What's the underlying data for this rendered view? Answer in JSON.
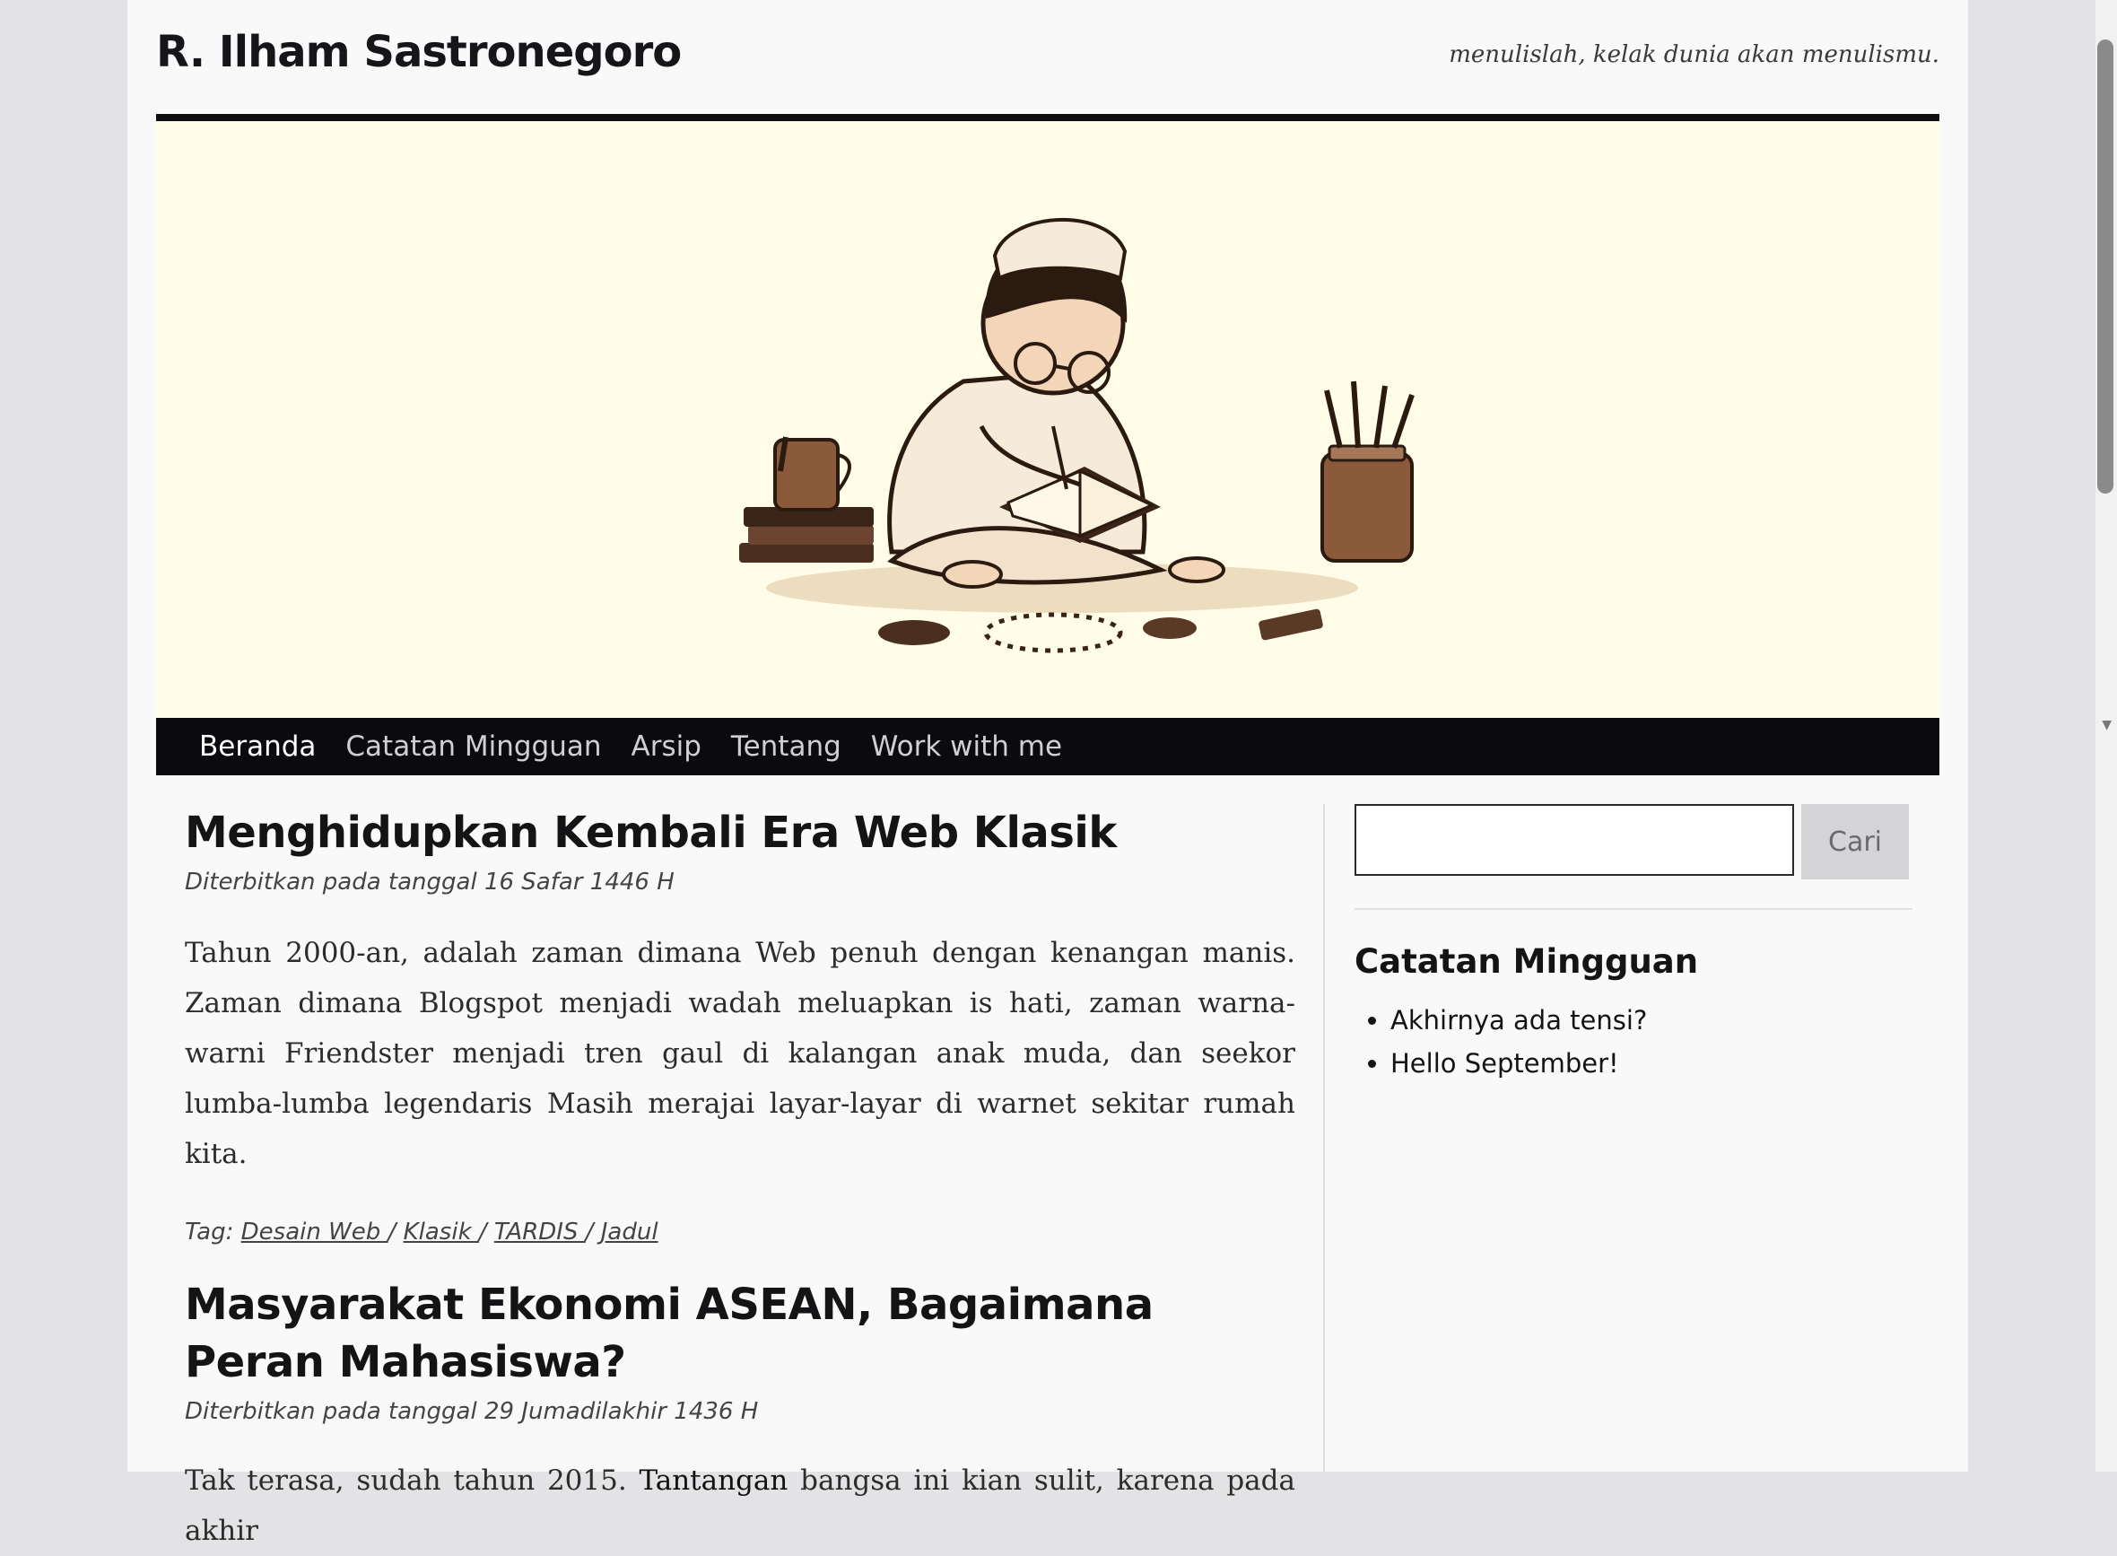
{
  "site": {
    "title": "R. Ilham Sastronegoro",
    "tagline": "menulislah, kelak dunia akan menulismu."
  },
  "hero": {
    "icon": "illustration-boy-writing"
  },
  "nav": {
    "items": [
      {
        "label": "Beranda"
      },
      {
        "label": "Catatan Mingguan"
      },
      {
        "label": "Arsip"
      },
      {
        "label": "Tentang"
      },
      {
        "label": "Work with me"
      }
    ]
  },
  "posts": [
    {
      "title": "Menghidupkan Kembali Era Web Klasik",
      "meta": "Diterbitkan pada tanggal 16 Safar 1446 H",
      "body": "Tahun 2000-an, adalah zaman dimana Web penuh dengan kenangan manis. Zaman dimana Blogspot menjadi wadah meluapkan is hati, zaman warna-warni Friendster menjadi tren gaul di kalangan anak muda, dan seekor lumba-lumba legendaris Masih merajai layar-layar di warnet sekitar rumah kita.",
      "tag_prefix": "Tag:",
      "tags": [
        "Desain Web ",
        "Klasik ",
        "TARDIS ",
        "Jadul"
      ]
    },
    {
      "title": "Masyarakat Ekonomi ASEAN, Bagaimana Peran Mahasiswa?",
      "meta": "Diterbitkan pada tanggal 29 Jumadilakhir 1436 H",
      "body_start": "Tak terasa, sudah tahun 2015.",
      "body_highlight": "Tantangan",
      "body_end": "bangsa ini kian sulit, karena pada akhir"
    }
  ],
  "sidebar": {
    "search_button": "Cari",
    "search_placeholder": "",
    "section_title": "Catatan Mingguan",
    "items": [
      "Akhirnya ada tensi?",
      "Hello September!"
    ]
  },
  "colors": {
    "background": "#e3e3e6",
    "page": "#f9f9f9",
    "hero_bg": "#fffde8",
    "nav_bg": "#0b0b0f",
    "text": "#141416"
  }
}
